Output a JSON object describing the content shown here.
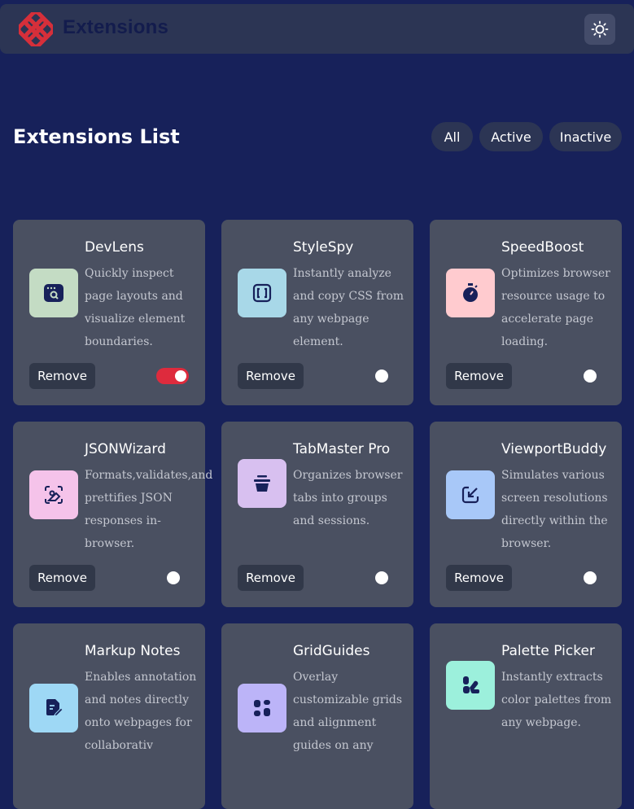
{
  "header": {
    "title": "Extensions",
    "theme_icon": "sun-icon",
    "brand_color": "#d62f3a"
  },
  "list": {
    "title": "Extensions List",
    "filters": [
      "All",
      "Active",
      "Inactive"
    ]
  },
  "cards": [
    {
      "name": "DevLens",
      "desc": "Quickly inspect page layouts and visualize element boundaries.",
      "remove": "Remove",
      "icon": "window-search-icon",
      "icon_bg": "#c4dcc4",
      "active": true
    },
    {
      "name": "StyleSpy",
      "desc": "Instantly analyze and copy CSS from any webpage element.",
      "remove": "Remove",
      "icon": "code-brackets-icon",
      "icon_bg": "#a8d8e8",
      "active": false
    },
    {
      "name": "SpeedBoost",
      "desc": "Optimizes browser resource usage to accelerate page loading.",
      "remove": "Remove",
      "icon": "stopwatch-icon",
      "icon_bg": "#ffcbcf",
      "active": false
    },
    {
      "name": "JSONWizard",
      "desc": "Formats,validates,and prettifies JSON responses in-browser.",
      "remove": "Remove",
      "icon": "image-edit-icon",
      "icon_bg": "#f5c3ea",
      "active": false
    },
    {
      "name": "TabMaster Pro",
      "desc": "Organizes browser tabs into groups and sessions.",
      "remove": "Remove",
      "icon": "tab-stack-icon",
      "icon_bg": "#d8c0f0",
      "active": false
    },
    {
      "name": "ViewportBuddy",
      "desc": "Simulates various screen resolutions directly within the browser.",
      "remove": "Remove",
      "icon": "resize-arrow-icon",
      "icon_bg": "#a8c8f8",
      "active": false
    },
    {
      "name": "Markup Notes",
      "desc": "Enables annotation and notes directly onto webpages for collaborativ",
      "remove": "Remove",
      "icon": "document-pen-icon",
      "icon_bg": "#9ed8f5",
      "active": false
    },
    {
      "name": "GridGuides",
      "desc": "Overlay customizable grids and alignment guides on any",
      "remove": "Remove",
      "icon": "grid-icon",
      "icon_bg": "#bcb4f8",
      "active": false
    },
    {
      "name": "Palette Picker",
      "desc": "Instantly extracts color palettes from any webpage.",
      "remove": "Remove",
      "icon": "palette-icon",
      "icon_bg": "#9cf0dc",
      "active": false
    }
  ]
}
